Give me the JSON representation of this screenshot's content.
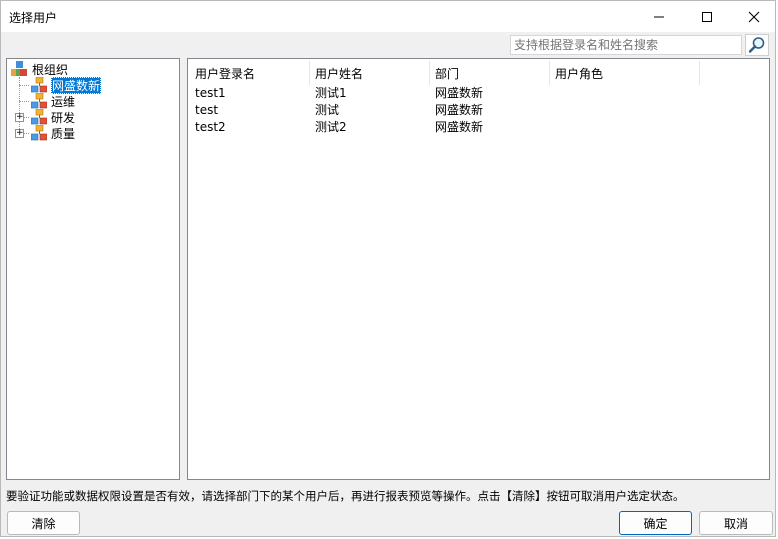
{
  "window": {
    "title": "选择用户"
  },
  "search": {
    "placeholder": "支持根据登录名和姓名搜索",
    "value": ""
  },
  "tree": {
    "root": "根组织",
    "nodes": [
      {
        "label": "网盛数新",
        "selected": true,
        "expandable": false
      },
      {
        "label": "运维",
        "selected": false,
        "expandable": false
      },
      {
        "label": "研发",
        "selected": false,
        "expandable": true
      },
      {
        "label": "质量",
        "selected": false,
        "expandable": true
      }
    ]
  },
  "table": {
    "columns": [
      "用户登录名",
      "用户姓名",
      "部门",
      "用户角色"
    ],
    "rows": [
      [
        "test1",
        "测试1",
        "网盛数新",
        ""
      ],
      [
        "test",
        "测试",
        "网盛数新",
        ""
      ],
      [
        "test2",
        "测试2",
        "网盛数新",
        ""
      ]
    ]
  },
  "hint": "要验证功能或数据权限设置是否有效，请选择部门下的某个用户后，再进行报表预览等操作。点击【清除】按钮可取消用户选定状态。",
  "buttons": {
    "clear": "清除",
    "ok": "确定",
    "cancel": "取消"
  },
  "colors": {
    "selection": "#0078d7",
    "primary_border": "#0067c0"
  }
}
